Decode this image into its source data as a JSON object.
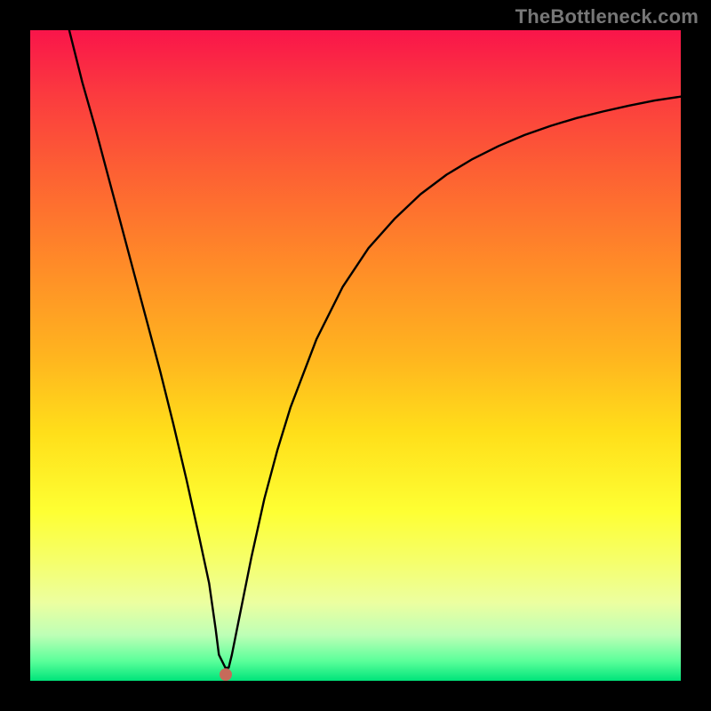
{
  "watermark": "TheBottleneck.com",
  "colors": {
    "frame_bg": "#000000",
    "curve_stroke": "#000000",
    "dot_fill": "#c66a5a",
    "gradient_stops": [
      "#f9154a",
      "#fb3b3f",
      "#fd6133",
      "#ff8b28",
      "#ffb41f",
      "#ffdf1a",
      "#feff33",
      "#f5ff6e",
      "#ecffa0",
      "#bdffb6",
      "#5aff9a",
      "#00e47a"
    ]
  },
  "chart_data": {
    "type": "line",
    "title": "",
    "xlabel": "",
    "ylabel": "",
    "xlim": [
      0,
      100
    ],
    "ylim": [
      0,
      100
    ],
    "series": [
      {
        "name": "bottleneck-curve",
        "x": [
          6,
          8,
          10,
          12,
          14,
          16,
          18,
          20,
          22,
          24,
          26,
          27.5,
          28.5,
          29,
          30,
          30.5,
          31,
          32,
          34,
          36,
          38,
          40,
          44,
          48,
          52,
          56,
          60,
          64,
          68,
          72,
          76,
          80,
          84,
          88,
          92,
          96,
          100
        ],
        "y": [
          100,
          92,
          85,
          77.5,
          70,
          62.5,
          55,
          47.5,
          39.5,
          31,
          22,
          15,
          8,
          4,
          2,
          2,
          4,
          9,
          19,
          28,
          35.5,
          42,
          52.5,
          60.5,
          66.5,
          71,
          74.8,
          77.8,
          80.2,
          82.2,
          83.9,
          85.3,
          86.5,
          87.5,
          88.4,
          89.2,
          89.8
        ]
      }
    ],
    "marker": {
      "x": 30,
      "y": 1
    }
  }
}
